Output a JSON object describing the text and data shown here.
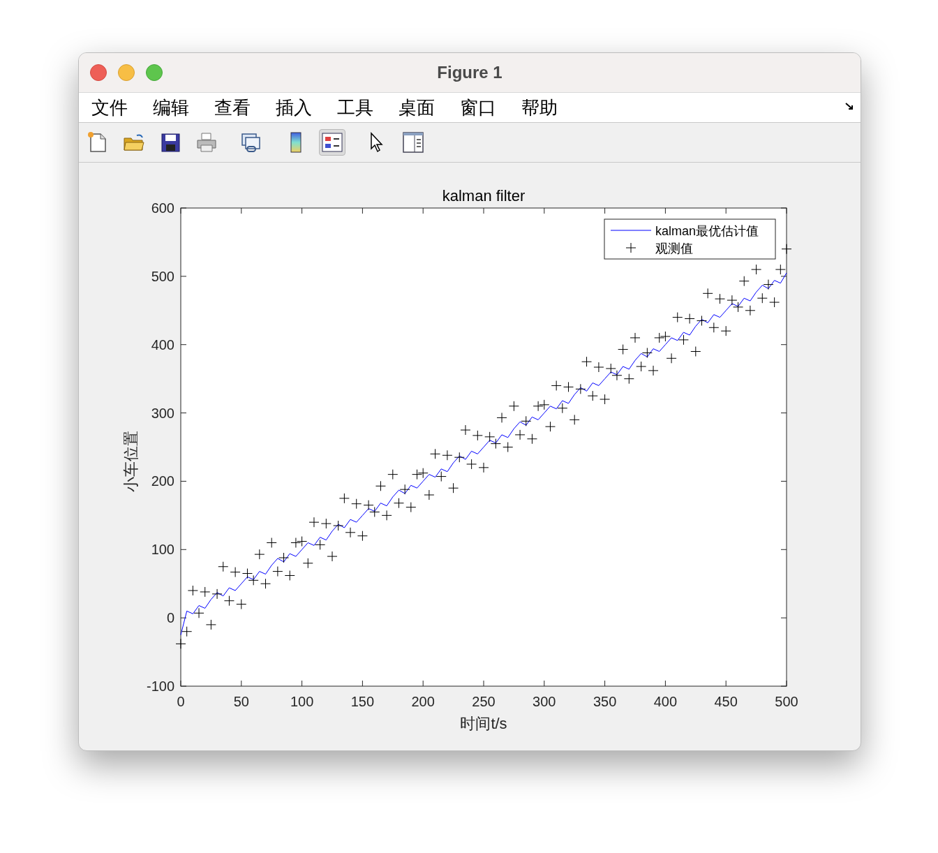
{
  "window": {
    "title": "Figure 1"
  },
  "menu": [
    {
      "label": "文件"
    },
    {
      "label": "编辑"
    },
    {
      "label": "查看"
    },
    {
      "label": "插入"
    },
    {
      "label": "工具"
    },
    {
      "label": "桌面"
    },
    {
      "label": "窗口"
    },
    {
      "label": "帮助"
    }
  ],
  "toolbar": [
    [
      {
        "kind": "new",
        "selected": false
      },
      {
        "kind": "open",
        "selected": false
      },
      {
        "kind": "save",
        "selected": false
      },
      {
        "kind": "print",
        "selected": false
      }
    ],
    [
      {
        "kind": "link",
        "selected": false
      }
    ],
    [
      {
        "kind": "colorbar",
        "selected": false
      },
      {
        "kind": "legend",
        "selected": true
      }
    ],
    [
      {
        "kind": "pointer",
        "selected": false
      },
      {
        "kind": "panel",
        "selected": false
      }
    ]
  ],
  "figure": {
    "chart_data": {
      "type": "line",
      "title": "kalman filter",
      "xlabel": "时间t/s",
      "ylabel": "小车位置",
      "legend": true,
      "xlim": [
        0,
        500
      ],
      "ylim": [
        -100,
        600
      ],
      "xticks": [
        0,
        50,
        100,
        150,
        200,
        250,
        300,
        350,
        400,
        450,
        500
      ],
      "yticks": [
        -100,
        0,
        100,
        200,
        300,
        400,
        500,
        600
      ],
      "x": [
        0,
        5,
        10,
        15,
        20,
        25,
        30,
        35,
        40,
        45,
        50,
        55,
        60,
        65,
        70,
        75,
        80,
        85,
        90,
        95,
        100,
        105,
        110,
        115,
        120,
        125,
        130,
        135,
        140,
        145,
        150,
        155,
        160,
        165,
        170,
        175,
        180,
        185,
        190,
        195,
        200,
        205,
        210,
        215,
        220,
        225,
        230,
        235,
        240,
        245,
        250,
        255,
        260,
        265,
        270,
        275,
        280,
        285,
        290,
        295,
        300,
        305,
        310,
        315,
        320,
        325,
        330,
        335,
        340,
        345,
        350,
        355,
        360,
        365,
        370,
        375,
        380,
        385,
        390,
        395,
        400,
        405,
        410,
        415,
        420,
        425,
        430,
        435,
        440,
        445,
        450,
        455,
        460,
        465,
        470,
        475,
        480,
        485,
        490,
        495,
        500
      ],
      "series": [
        {
          "name": "kalman最优估计值",
          "color": "#0000ff",
          "values": [
            -25,
            10,
            6,
            18,
            14,
            27,
            37,
            32,
            44,
            40,
            50,
            60,
            56,
            68,
            64,
            77,
            87,
            82,
            94,
            90,
            100,
            110,
            106,
            118,
            114,
            127,
            137,
            132,
            144,
            140,
            150,
            160,
            156,
            168,
            164,
            177,
            187,
            182,
            194,
            190,
            200,
            210,
            206,
            218,
            214,
            227,
            237,
            232,
            244,
            240,
            250,
            260,
            256,
            268,
            264,
            277,
            287,
            282,
            294,
            290,
            300,
            310,
            306,
            318,
            314,
            327,
            337,
            332,
            344,
            340,
            350,
            360,
            356,
            368,
            364,
            377,
            387,
            382,
            394,
            390,
            400,
            410,
            406,
            418,
            414,
            427,
            437,
            432,
            444,
            440,
            450,
            460,
            456,
            468,
            464,
            477,
            487,
            482,
            494,
            490,
            505
          ]
        },
        {
          "name": "观测值",
          "color": "#000000",
          "type": "scatter",
          "marker": "+",
          "values": [
            -38,
            -20,
            40,
            7,
            38,
            -10,
            35,
            75,
            25,
            67,
            20,
            65,
            55,
            93,
            50,
            110,
            68,
            88,
            62,
            110,
            112,
            80,
            140,
            107,
            138,
            90,
            135,
            175,
            125,
            167,
            120,
            165,
            155,
            193,
            150,
            210,
            168,
            188,
            162,
            210,
            212,
            180,
            240,
            207,
            238,
            190,
            235,
            275,
            225,
            267,
            220,
            265,
            255,
            293,
            250,
            310,
            268,
            288,
            262,
            310,
            312,
            280,
            340,
            307,
            338,
            290,
            335,
            375,
            325,
            367,
            320,
            365,
            355,
            393,
            350,
            410,
            368,
            388,
            362,
            410,
            412,
            380,
            440,
            407,
            438,
            390,
            435,
            475,
            425,
            467,
            420,
            465,
            455,
            493,
            450,
            510,
            468,
            488,
            462,
            510,
            540
          ]
        }
      ]
    }
  }
}
